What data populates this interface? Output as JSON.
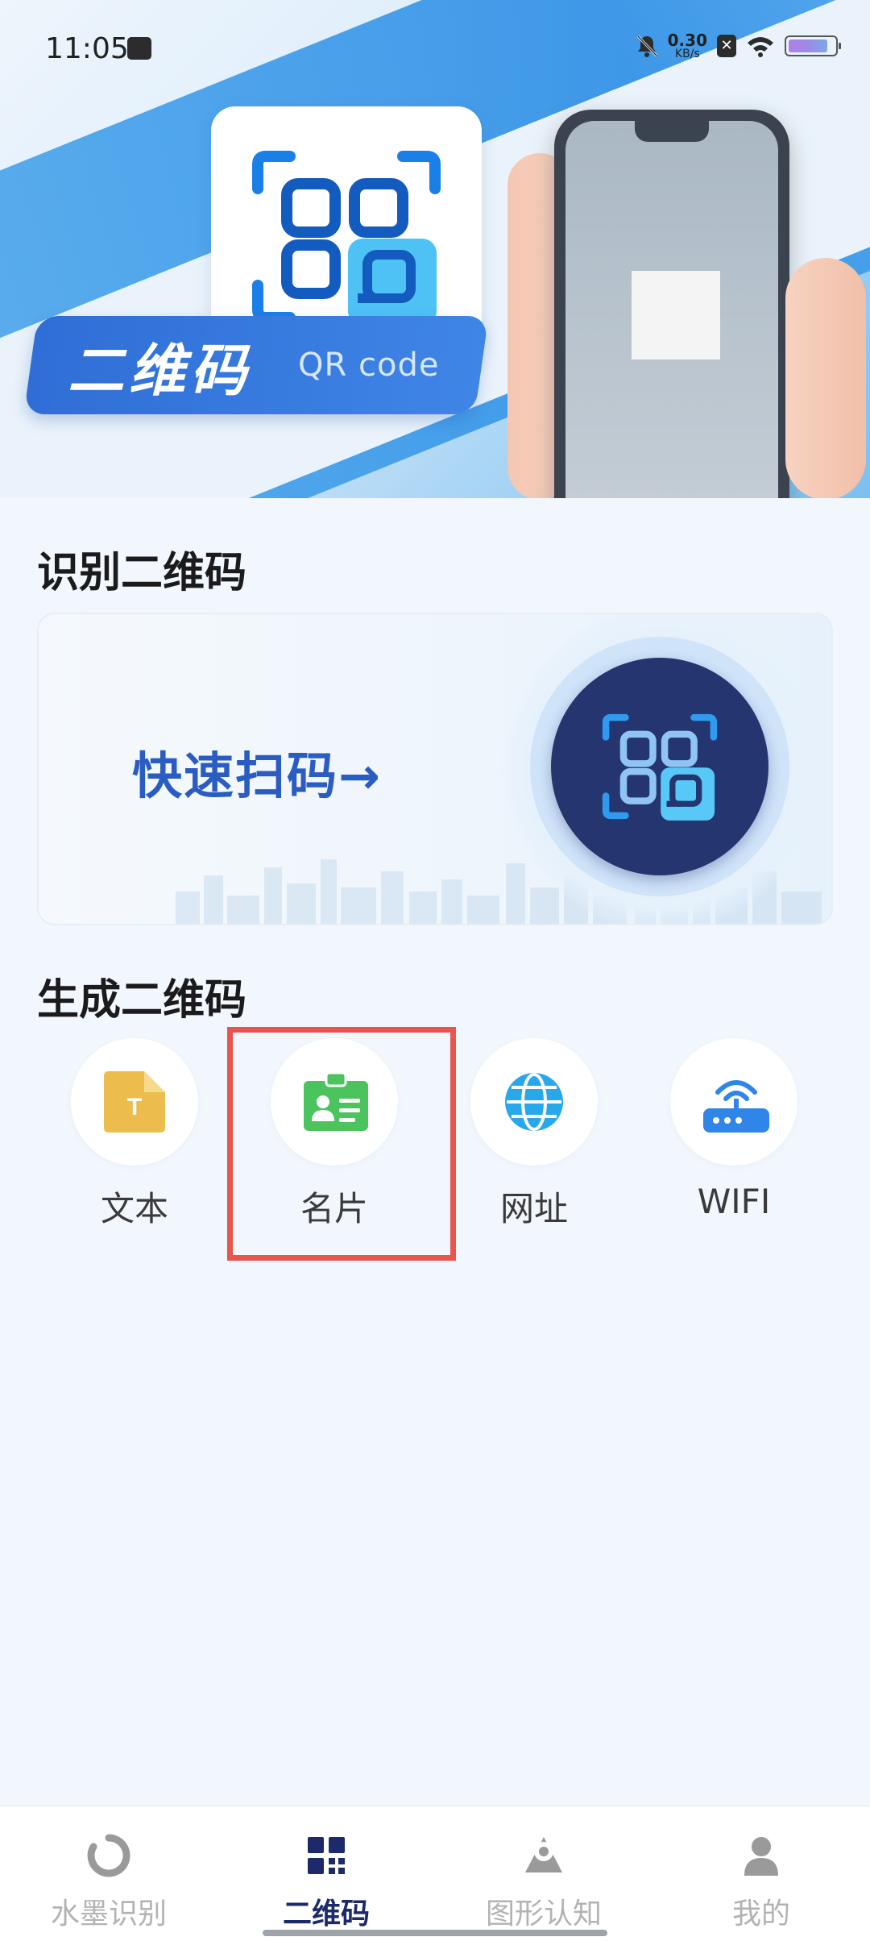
{
  "status_bar": {
    "time": "11:05",
    "net_speed_value": "0.30",
    "net_speed_unit": "KB/s",
    "battery_percent": 85
  },
  "hero": {
    "title_cn": "二维码",
    "title_en": "QR code"
  },
  "recognize_section": {
    "title": "识别二维码",
    "scan_label": "快速扫码→"
  },
  "generate_section": {
    "title": "生成二维码",
    "items": [
      {
        "label": "文本",
        "icon": "text-doc-icon",
        "color": "#ecbd4d"
      },
      {
        "label": "名片",
        "icon": "business-card-icon",
        "color": "#4cc45e"
      },
      {
        "label": "网址",
        "icon": "globe-icon",
        "color": "#27a8ea"
      },
      {
        "label": "WIFI",
        "icon": "wifi-router-icon",
        "color": "#2f86e8"
      }
    ]
  },
  "bottom_nav": {
    "items": [
      {
        "label": "水墨识别",
        "icon": "ink-circle-icon"
      },
      {
        "label": "二维码",
        "icon": "qr-code-icon",
        "active": true
      },
      {
        "label": "图形认知",
        "icon": "shape-recognition-icon"
      },
      {
        "label": "我的",
        "icon": "profile-icon"
      }
    ]
  },
  "colors": {
    "accent": "#1c2a6b",
    "highlight_border": "#e9544d",
    "scan_text": "#2a5cc2"
  }
}
